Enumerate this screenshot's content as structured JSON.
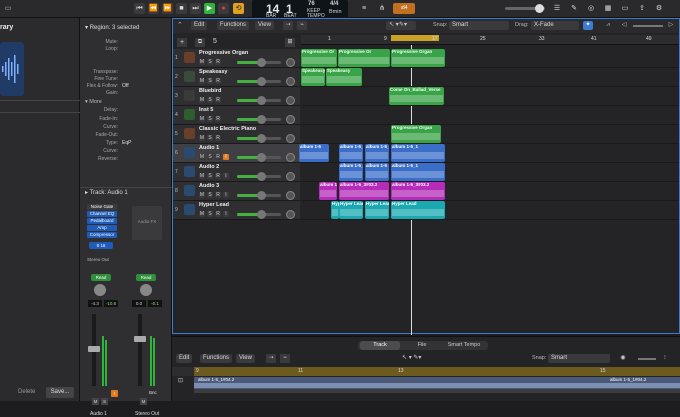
{
  "colors": {
    "accent": "#3d7bd1",
    "region_green": "#39a347",
    "region_blue": "#3a6ec9",
    "region_magenta": "#b42cb8",
    "region_cyan": "#1aa8b1",
    "play": "#2fb33d"
  },
  "lcd": {
    "bar": "14",
    "beat": "1",
    "tempo": "76",
    "tempo_label": "KEEP",
    "signature": "4/4",
    "key": "Bmin",
    "bar_label": "BAR",
    "beat_label": "BEAT",
    "tempo_sub": "TEMPO"
  },
  "cpu_badge": "ıd4",
  "library": {
    "title": "rary"
  },
  "inspector": {
    "region_header": "Region: 3 selected",
    "rows": [
      {
        "k": "Mute:",
        "v": ""
      },
      {
        "k": "Loop:",
        "v": ""
      },
      {
        "k": "Transpose:",
        "v": ""
      },
      {
        "k": "Fine Tune:",
        "v": ""
      },
      {
        "k": "Flex & Follow:",
        "v": "Off"
      },
      {
        "k": "Gain:",
        "v": ""
      }
    ],
    "more_label": "More",
    "more_rows": [
      {
        "k": "Delay:",
        "v": ""
      },
      {
        "k": "Fade-In:",
        "v": ""
      },
      {
        "k": "Curve:",
        "v": ""
      },
      {
        "k": "Fade-Out:",
        "v": ""
      },
      {
        "k": "Type:",
        "v": "EqP"
      },
      {
        "k": "Curve:",
        "v": ""
      },
      {
        "k": "Reverse:",
        "v": ""
      }
    ],
    "track_header": "Track: Audio 1",
    "plugins": [
      "Noise Gate",
      "Channel EQ",
      "Pedalboard",
      "Amp",
      "Compressor"
    ],
    "audio_fx": "Audio FX",
    "channel_in": "8 16",
    "stereo_out": "Stereo Out",
    "read": "Read",
    "vol_a": "-4.3",
    "pan_a": "-10.6",
    "vol_b": "0.0",
    "pan_b": "-0.1",
    "strip_a_name": "Audio 1",
    "strip_b_name": "Stereo Out",
    "bnc": "Bnc",
    "delete": "Delete",
    "save": "Save..."
  },
  "tracks_toolbar": {
    "edit": "Edit",
    "functions": "Functions",
    "view": "View",
    "snap_label": "Snap:",
    "snap_value": "Smart",
    "drag_label": "Drag:",
    "drag_value": "X-Fade",
    "count": "5"
  },
  "ruler": [
    "1",
    "9",
    "17",
    "25",
    "33",
    "41",
    "49"
  ],
  "tracks": [
    {
      "num": "1",
      "name": "Progressive Organ"
    },
    {
      "num": "2",
      "name": "Speakeasy"
    },
    {
      "num": "3",
      "name": "Bluebird"
    },
    {
      "num": "4",
      "name": "Inst 5"
    },
    {
      "num": "5",
      "name": "Classic Electric Piano"
    },
    {
      "num": "6",
      "name": "Audio 1"
    },
    {
      "num": "7",
      "name": "Audio 2"
    },
    {
      "num": "8",
      "name": "Audio 3"
    },
    {
      "num": "9",
      "name": "Hyper Lead"
    }
  ],
  "regions": {
    "r1a": "Progressive Or",
    "r1b": "Progressive Or",
    "r1c": "Progressive Organ",
    "r2a": "Speakeasy",
    "r2b": "Speakeasy",
    "r3a": "Come On_Ballad_Verse",
    "r5a": "Progressive Organ",
    "r6a": "album 1-5",
    "r6b": "album 1-5_1",
    "r6c": "album 1-5_1",
    "r6d": "album 1-5_1",
    "r7a": "album 1-5_1",
    "r7b": "album 1-5",
    "r7c": "album 1-5_1",
    "r8a": "album 1",
    "r8b": "album 1-5_3#03.2",
    "r8c": "album 1-5_3#03.2",
    "r9a": "Hyper Lead",
    "r9b": "Hyper Lead",
    "r9c": "Hyper Lead",
    "r9d": "Hyper Lead"
  },
  "bottom": {
    "tabs": [
      "Track",
      "File",
      "Smart Tempo"
    ],
    "edit": "Edit",
    "functions": "Functions",
    "view": "View",
    "snap_label": "Snap:",
    "snap_value": "Smart",
    "ruler": [
      "9",
      "11",
      "13",
      "15"
    ],
    "region_a": "album 1-5_1#04.2",
    "region_b": "album 1-5_1#04.2"
  }
}
